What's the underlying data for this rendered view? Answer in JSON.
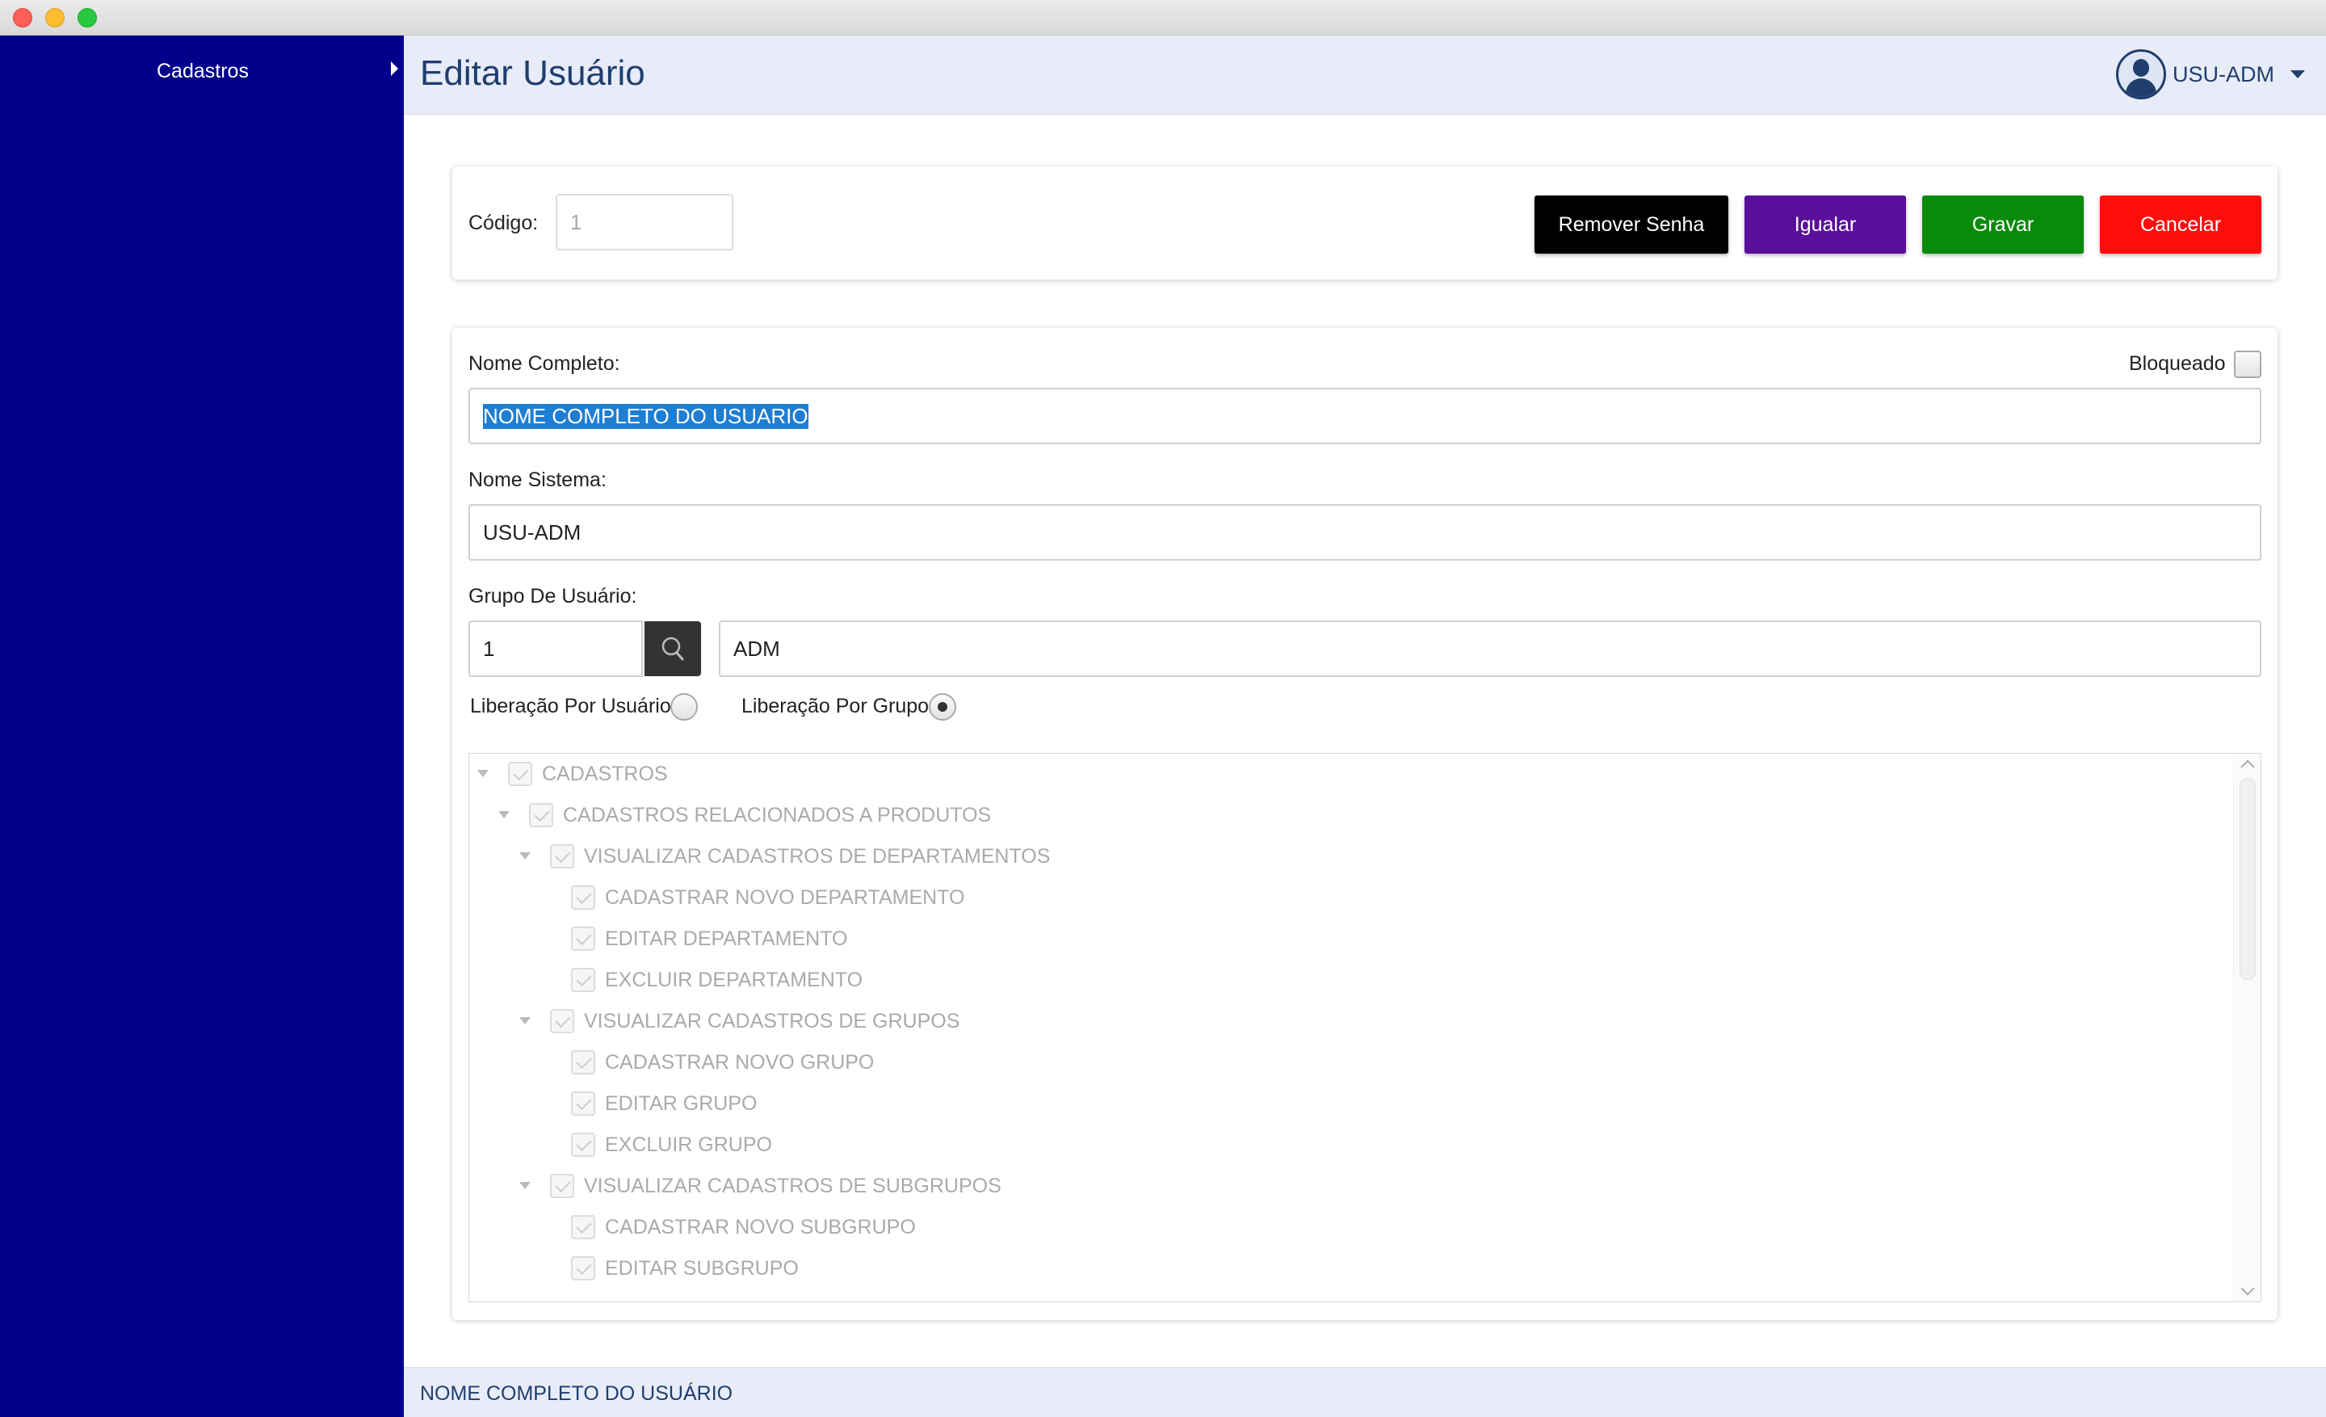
{
  "sidebar": {
    "items": [
      {
        "label": "Cadastros"
      }
    ]
  },
  "header": {
    "title": "Editar Usuário",
    "user": "USU-ADM"
  },
  "toolbar": {
    "codigo_label": "Código:",
    "codigo_value": "1",
    "buttons": {
      "remover_senha": "Remover Senha",
      "igualar": "Igualar",
      "gravar": "Gravar",
      "cancelar": "Cancelar"
    },
    "colors": {
      "remover_senha": "#000000",
      "igualar": "#5a0f9b",
      "gravar": "#0a8a0a",
      "cancelar": "#ff0d0d"
    }
  },
  "form": {
    "nome_completo_label": "Nome Completo:",
    "nome_completo_value": "NOME COMPLETO DO USUARIO",
    "bloqueado_label": "Bloqueado",
    "bloqueado_checked": false,
    "nome_sistema_label": "Nome Sistema:",
    "nome_sistema_value": "USU-ADM",
    "grupo_label": "Grupo De Usuário:",
    "grupo_code": "1",
    "grupo_name": "ADM",
    "liberacao_usuario_label": "Liberação Por Usuário",
    "liberacao_grupo_label": "Liberação Por Grupo",
    "liberacao_selected": "grupo"
  },
  "tree": {
    "items": [
      {
        "label": "CADASTROS",
        "level": 0,
        "expandable": true
      },
      {
        "label": "CADASTROS RELACIONADOS A PRODUTOS",
        "level": 1,
        "expandable": true
      },
      {
        "label": "VISUALIZAR CADASTROS DE DEPARTAMENTOS",
        "level": 2,
        "expandable": true
      },
      {
        "label": "CADASTRAR NOVO DEPARTAMENTO",
        "level": 3,
        "expandable": false
      },
      {
        "label": "EDITAR DEPARTAMENTO",
        "level": 3,
        "expandable": false
      },
      {
        "label": "EXCLUIR DEPARTAMENTO",
        "level": 3,
        "expandable": false
      },
      {
        "label": "VISUALIZAR CADASTROS DE GRUPOS",
        "level": 2,
        "expandable": true
      },
      {
        "label": "CADASTRAR NOVO GRUPO",
        "level": 3,
        "expandable": false
      },
      {
        "label": "EDITAR GRUPO",
        "level": 3,
        "expandable": false
      },
      {
        "label": "EXCLUIR GRUPO",
        "level": 3,
        "expandable": false
      },
      {
        "label": "VISUALIZAR CADASTROS DE SUBGRUPOS",
        "level": 2,
        "expandable": true
      },
      {
        "label": "CADASTRAR NOVO SUBGRUPO",
        "level": 3,
        "expandable": false
      },
      {
        "label": "EDITAR SUBGRUPO",
        "level": 3,
        "expandable": false
      }
    ]
  },
  "status": {
    "text": "NOME COMPLETO DO USUÁRIO"
  }
}
